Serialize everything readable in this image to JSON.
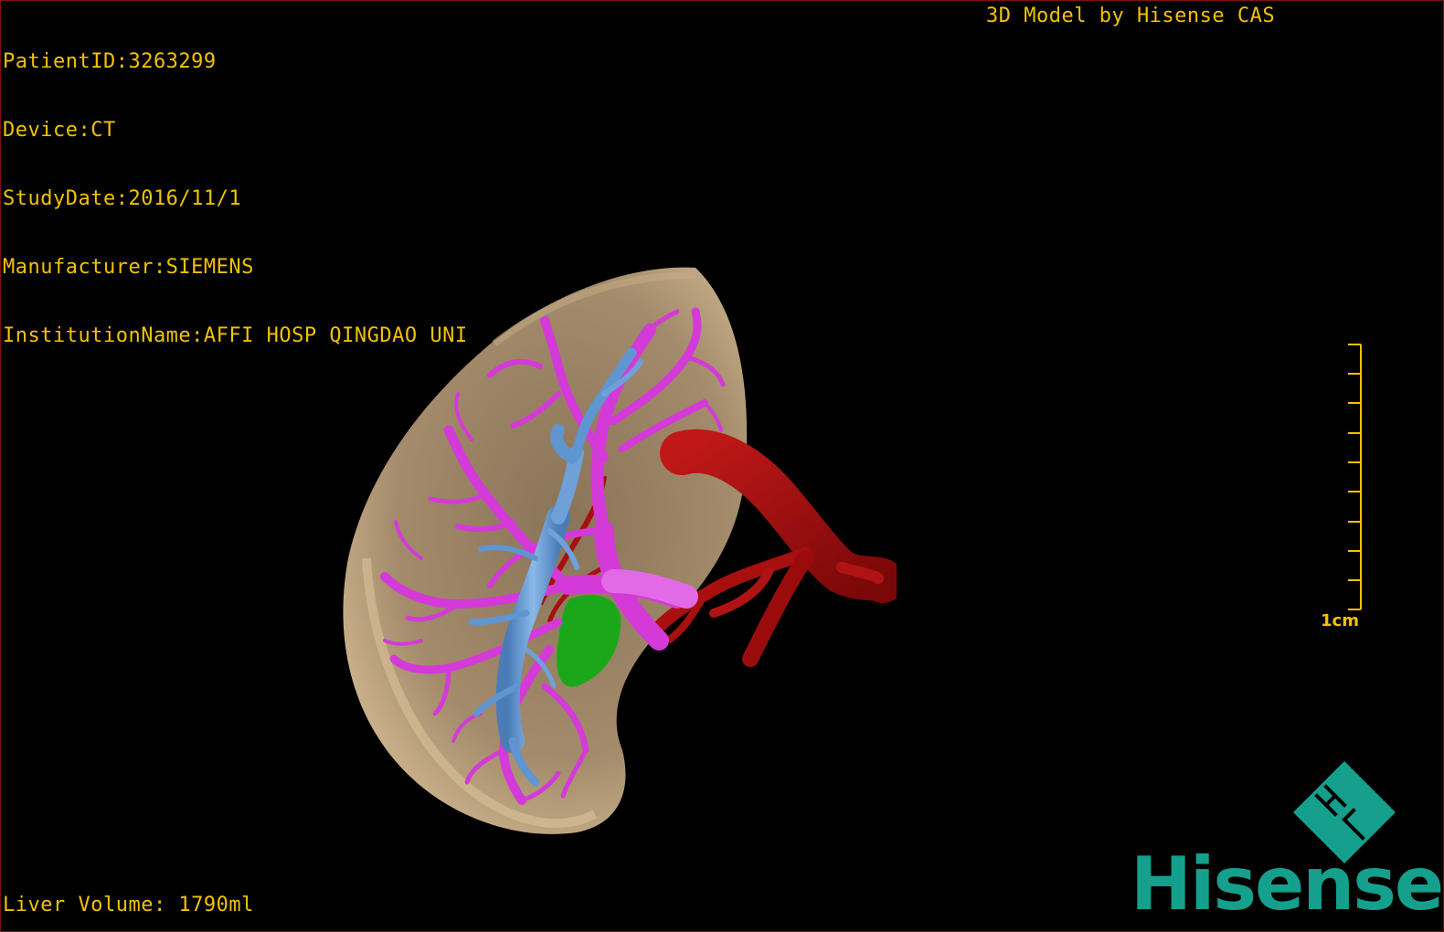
{
  "study_info": [
    "PatientID:3263299",
    "Device:CT",
    "StudyDate:2016/11/1",
    "Manufacturer:SIEMENS",
    "InstitutionName:AFFI HOSP QINGDAO UNI"
  ],
  "brand_caption": "3D Model by Hisense CAS",
  "measurement": {
    "liver_volume": "Liver Volume: 1790ml"
  },
  "scale": {
    "label": "1cm"
  },
  "logo": {
    "mark_icon": "hisense-ht-logo-icon",
    "wordmark": "Hisense"
  },
  "colors": {
    "overlay_text": "#f2c200",
    "border": "#7a1010",
    "liver": "#a0896a",
    "hepatic_vein": "#d43ad8",
    "portal_vein": "#5f95d0",
    "artery": "#a80f0f",
    "gallbladder": "#1aa81a",
    "brand": "#14a08c"
  }
}
